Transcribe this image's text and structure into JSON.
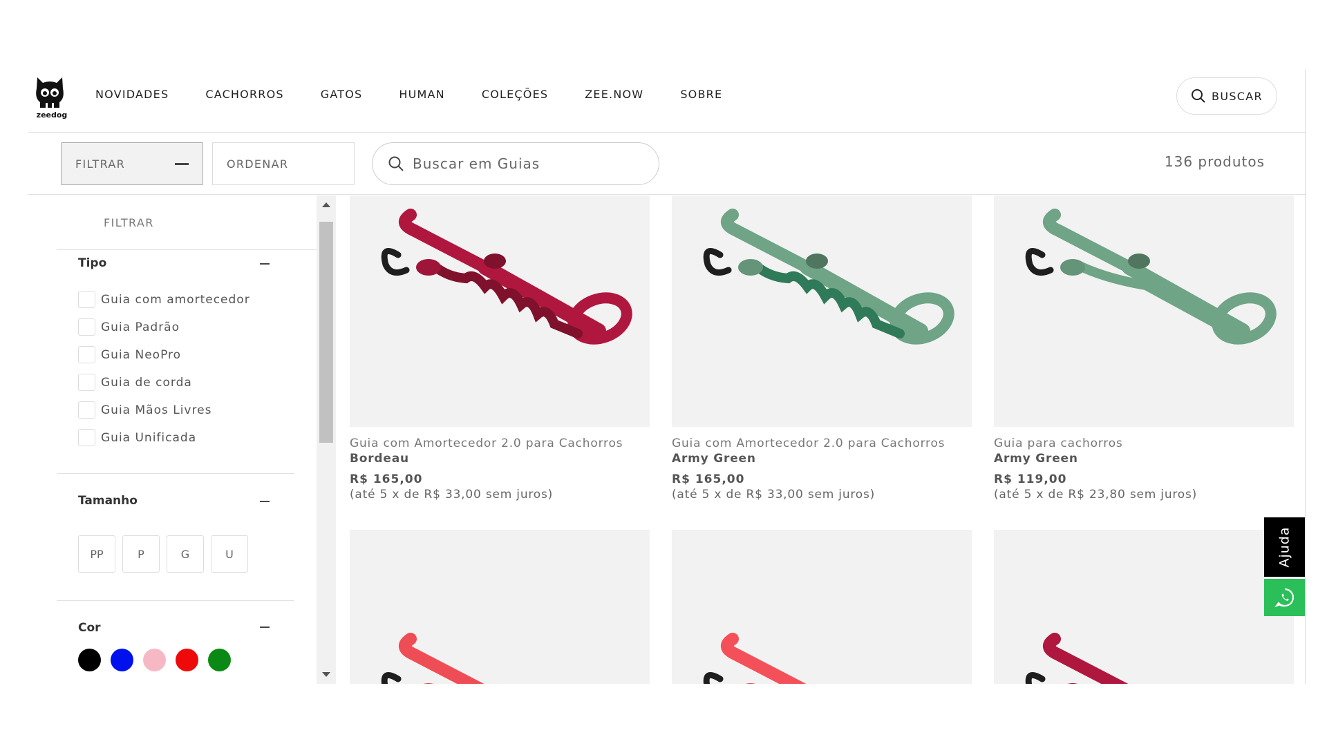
{
  "brand": {
    "name": "zeedog"
  },
  "nav": {
    "items": [
      "NOVIDADES",
      "CACHORROS",
      "GATOS",
      "HUMAN",
      "COLEÇÕES",
      "ZEE.NOW",
      "SOBRE"
    ],
    "search_label": "BUSCAR"
  },
  "toolbar": {
    "filter_label": "FILTRAR",
    "order_label": "ORDENAR",
    "search_placeholder": "Buscar em Guias",
    "count": "136 produtos"
  },
  "sidebar": {
    "title": "FILTRAR",
    "tipo": {
      "heading": "Tipo",
      "options": [
        "Guia com amortecedor",
        "Guia Padrão",
        "Guia NeoPro",
        "Guia de corda",
        "Guia Mãos Livres",
        "Guia Unificada"
      ]
    },
    "tamanho": {
      "heading": "Tamanho",
      "sizes": [
        "PP",
        "P",
        "G",
        "U"
      ]
    },
    "cor": {
      "heading": "Cor",
      "swatches": [
        "#000000",
        "#0011ee",
        "#f7b8c6",
        "#ee0a0a",
        "#0a8a14"
      ]
    }
  },
  "products": [
    {
      "name": "Guia com Amortecedor 2.0 para Cachorros",
      "color": "Bordeau",
      "price": "R$ 165,00",
      "installments": "(até 5 x de R$ 33,00 sem juros)",
      "strap_color": "#b0173f",
      "bungee": true
    },
    {
      "name": "Guia com Amortecedor 2.0 para Cachorros",
      "color": "Army Green",
      "price": "R$ 165,00",
      "installments": "(até 5 x de R$ 33,00 sem juros)",
      "strap_color": "#6fa486",
      "bungee": true
    },
    {
      "name": "Guia para cachorros",
      "color": "Army Green",
      "price": "R$ 119,00",
      "installments": "(até 5 x de R$ 23,80 sem juros)",
      "strap_color": "#6fa486",
      "bungee": false
    },
    {
      "strap_color": "#ef4d55"
    },
    {
      "strap_color": "#f4505a"
    },
    {
      "strap_color": "#b0173f"
    }
  ],
  "help": {
    "label": "Ajuda"
  }
}
